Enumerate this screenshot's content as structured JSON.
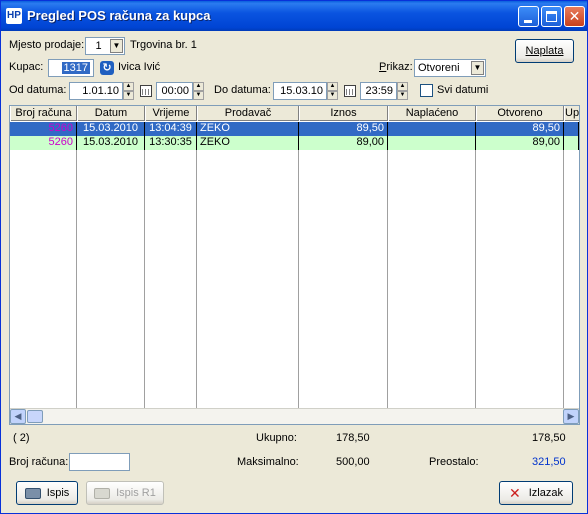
{
  "window": {
    "title": "Pregled POS računa za kupca",
    "app_icon": "app-icon"
  },
  "filters": {
    "mjesto_label": "Mjesto prodaje:",
    "mjesto_value": "1",
    "mjesto_name": "Trgovina br. 1",
    "kupac_label": "Kupac:",
    "kupac_value": "1317",
    "kupac_name": "Ivica Ivić",
    "prikaz_label": "Prikaz:",
    "prikaz_value": "Otvoreni",
    "od_datuma_label": "Od datuma:",
    "od_datum": "1.01.10",
    "od_vrijeme": "00:00",
    "do_datuma_label": "Do datuma:",
    "do_datum": "15.03.10",
    "do_vrijeme": "23:59",
    "svi_datumi_label": "Svi datumi",
    "svi_datumi_checked": false
  },
  "naplata_button": "Naplata",
  "table": {
    "columns": [
      "Broj računa",
      "Datum",
      "Vrijeme",
      "Prodavač",
      "Iznos",
      "Naplaćeno",
      "Otvoreno",
      "Upl"
    ],
    "rows": [
      {
        "broj": "5260",
        "datum": "15.03.2010",
        "vrijeme": "13:04:39",
        "prodavac": "ZEKO",
        "iznos": "89,50",
        "naplaceno": "",
        "otvoreno": "89,50",
        "selected": true
      },
      {
        "broj": "5260",
        "datum": "15.03.2010",
        "vrijeme": "13:30:35",
        "prodavac": "ZEKO",
        "iznos": "89,00",
        "naplaceno": "",
        "otvoreno": "89,00",
        "selected": false
      }
    ]
  },
  "summary": {
    "count": "(   2)",
    "ukupno_label": "Ukupno:",
    "ukupno_iznos": "178,50",
    "ukupno_otvoreno": "178,50",
    "maksimalno_label": "Maksimalno:",
    "maksimalno_value": "500,00",
    "preostalo_label": "Preostalo:",
    "preostalo_value": "321,50",
    "broj_racuna_label": "Broj računa:",
    "broj_racuna_value": ""
  },
  "buttons": {
    "ispis": "Ispis",
    "ispis_r1": "Ispis R1",
    "izlazak": "Izlazak"
  },
  "colors": {
    "selected_row": "#316ac5",
    "alt_row": "#ccffcc",
    "broj_text": "#cc00cc",
    "preostalo": "#0033cc"
  }
}
